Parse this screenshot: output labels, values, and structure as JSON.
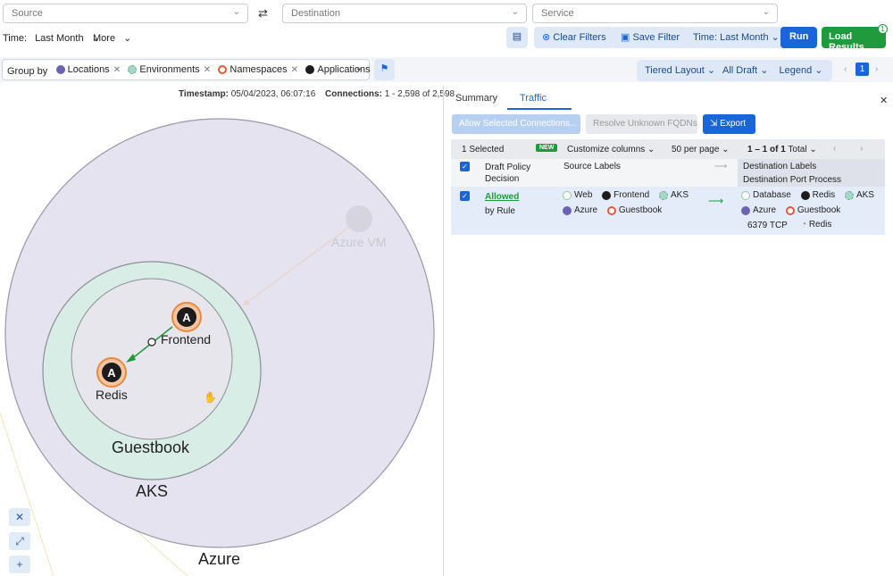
{
  "filters": {
    "source_placeholder": "Source",
    "destination_placeholder": "Destination",
    "service_placeholder": "Service",
    "time_label": "Time:",
    "time_value": "Last Month",
    "more_label": "More",
    "clear_filters": "Clear Filters",
    "save_filter": "Save Filter",
    "time_btn": "Time: Last Month",
    "run": "Run",
    "load_results": "Load Results",
    "load_badge": "1"
  },
  "groupby": {
    "label": "Group by",
    "chips": [
      "Locations",
      "Environments",
      "Namespaces",
      "Applications"
    ],
    "tiered_layout": "Tiered Layout",
    "all_draft": "All Draft",
    "legend": "Legend",
    "page": "1"
  },
  "map": {
    "timestamp_label": "Timestamp:",
    "timestamp_value": "05/04/2023, 06:07:16",
    "connections_label": "Connections:",
    "connections_value": "1 - 2,598 of 2,598",
    "nodes": {
      "azure": "Azure",
      "aks": "AKS",
      "guestbook": "Guestbook",
      "frontend": "Frontend",
      "redis": "Redis",
      "azure_vm": "Azure VM"
    }
  },
  "panel": {
    "tabs": [
      "Summary",
      "Traffic"
    ],
    "active_tab": "Traffic",
    "allow_btn": "Allow Selected Connections...",
    "resolve_btn": "Resolve Unknown FQDNs",
    "export_btn": "Export",
    "selected": "1 Selected",
    "new_badge": "NEW",
    "customize": "Customize columns",
    "per_page": "50 per page",
    "range": "1 – 1 of",
    "range_total": "1",
    "total_label": "Total",
    "col_decision": "Draft Policy Decision",
    "col_source": "Source Labels",
    "col_dest": "Destination Labels",
    "col_dest2": "Destination Port Process",
    "row": {
      "decision": "Allowed",
      "by_rule": "by Rule",
      "src_labels": [
        "Web",
        "Frontend",
        "AKS",
        "Azure",
        "Guestbook"
      ],
      "dst_labels": [
        "Database",
        "Redis",
        "AKS",
        "Azure",
        "Guestbook"
      ],
      "port": "6379 TCP",
      "process": "Redis"
    }
  },
  "colors": {
    "accent": "#1a66d9",
    "green": "#1f9a3d",
    "azure_fill": "#e4e3ef",
    "aks_fill": "#d9ede7",
    "ns_fill": "#e6e6ec"
  }
}
